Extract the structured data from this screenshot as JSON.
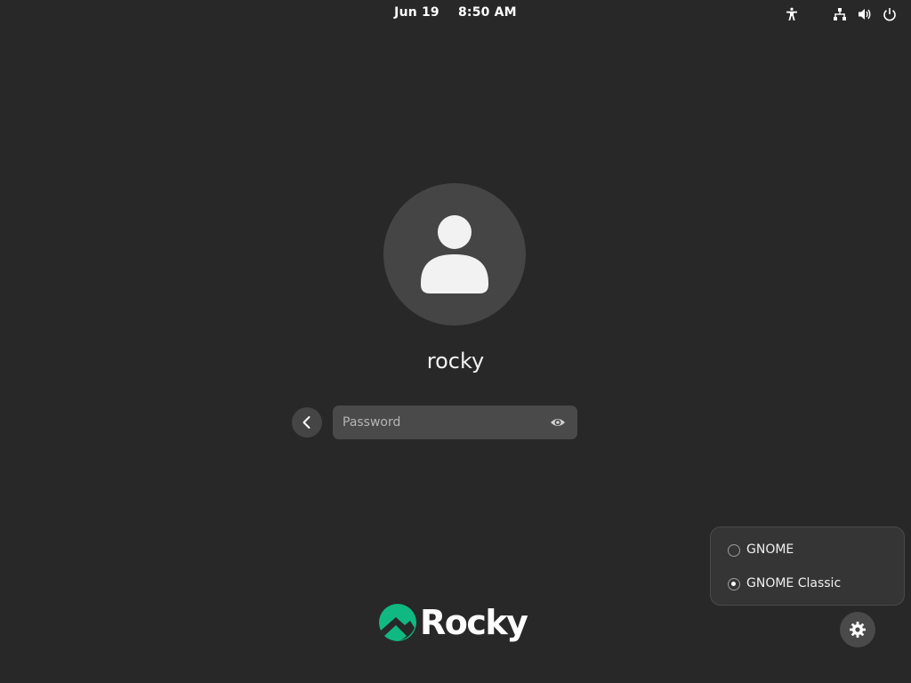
{
  "topbar": {
    "date": "Jun 19",
    "time": "8:50 AM",
    "icons": [
      "accessibility-icon",
      "network-icon",
      "volume-icon",
      "power-icon"
    ]
  },
  "user": {
    "name": "rocky"
  },
  "login": {
    "password_placeholder": "Password",
    "password_value": ""
  },
  "sessions": {
    "options": [
      {
        "label": "GNOME",
        "selected": false
      },
      {
        "label": "GNOME Classic",
        "selected": true
      }
    ]
  },
  "brand": {
    "name": "Rocky",
    "accent": "#10b981"
  },
  "colors": {
    "background": "#282828",
    "avatar_bg": "#454545",
    "field_bg": "#4a4a4a"
  }
}
